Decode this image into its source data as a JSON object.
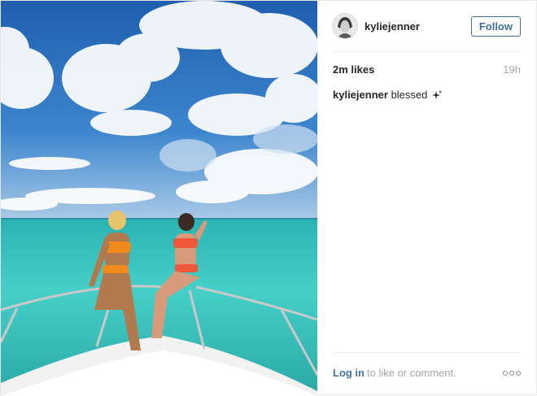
{
  "post": {
    "username": "kyliejenner",
    "follow_label": "Follow",
    "likes": "2m likes",
    "time_ago": "19h",
    "caption_user": "kyliejenner",
    "caption_text": "blessed"
  },
  "footer": {
    "login_label": "Log in",
    "login_rest": "to like or comment."
  },
  "colors": {
    "link_blue": "#3f729b",
    "muted_gray": "#a5a7aa",
    "sky": "#2e6db5",
    "sea": "#3fc8c4"
  },
  "icons": {
    "sparkle": "sparkle-icon",
    "more": "more-options-icon"
  }
}
